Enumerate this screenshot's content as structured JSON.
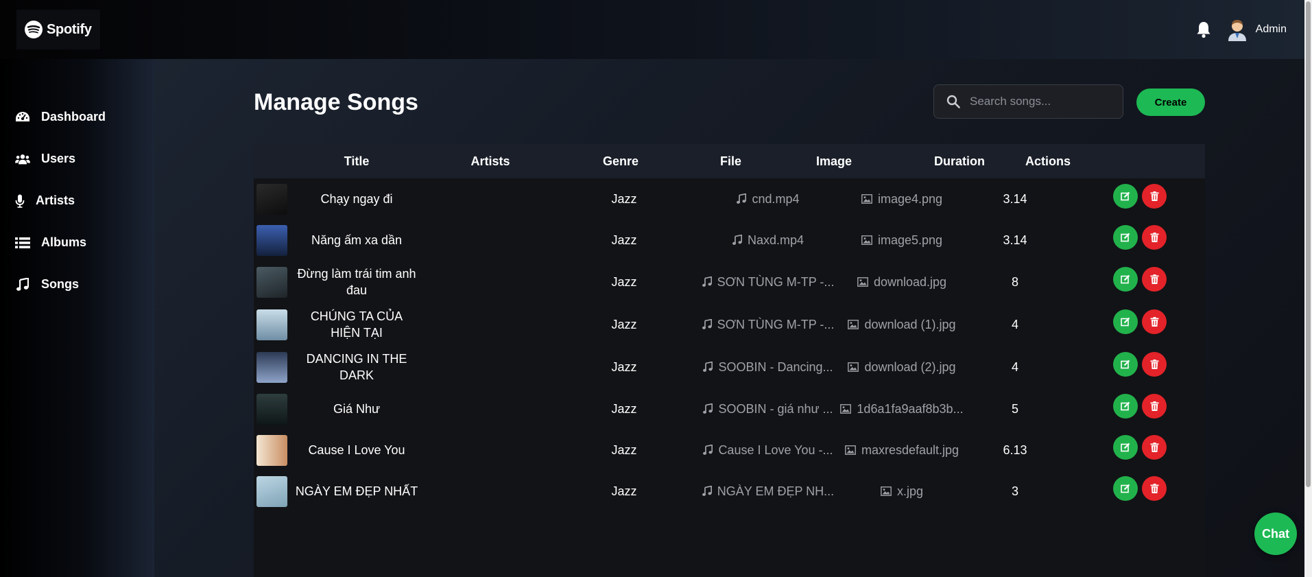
{
  "app": {
    "brand": "Spotify"
  },
  "header": {
    "user_name": "Admin"
  },
  "sidebar": {
    "items": [
      {
        "label": "Dashboard",
        "icon": "dashboard-icon"
      },
      {
        "label": "Users",
        "icon": "users-icon"
      },
      {
        "label": "Artists",
        "icon": "microphone-icon"
      },
      {
        "label": "Albums",
        "icon": "list-icon"
      },
      {
        "label": "Songs",
        "icon": "music-note-icon"
      }
    ]
  },
  "main": {
    "title": "Manage Songs",
    "search_placeholder": "Search songs...",
    "create_label": "Create"
  },
  "table": {
    "columns": [
      "Title",
      "Artists",
      "Genre",
      "File",
      "Image",
      "Duration",
      "Actions"
    ],
    "rows": [
      {
        "title": "Chạy ngay đi",
        "genre": "Jazz",
        "file": "cnd.mp4",
        "image": "image4.png",
        "duration": "3.14"
      },
      {
        "title": "Năng ấm xa dần",
        "genre": "Jazz",
        "file": "Naxd.mp4",
        "image": "image5.png",
        "duration": "3.14"
      },
      {
        "title": "Đừng làm trái tim anh đau",
        "genre": "Jazz",
        "file": "SƠN TÙNG M-TP -...",
        "image": "download.jpg",
        "duration": "8"
      },
      {
        "title": "CHÚNG TA CỦA HIỆN TẠI",
        "genre": "Jazz",
        "file": "SƠN TÙNG M-TP -...",
        "image": "download (1).jpg",
        "duration": "4"
      },
      {
        "title": "DANCING IN THE DARK",
        "genre": "Jazz",
        "file": "SOOBIN - Dancing...",
        "image": "download (2).jpg",
        "duration": "4"
      },
      {
        "title": "Giá Như",
        "genre": "Jazz",
        "file": "SOOBIN - giá như ...",
        "image": "1d6a1fa9aaf8b3b...",
        "duration": "5"
      },
      {
        "title": "Cause I Love You",
        "genre": "Jazz",
        "file": "Cause I Love You -...",
        "image": "maxresdefault.jpg",
        "duration": "6.13"
      },
      {
        "title": "NGÀY EM ĐẸP NHẤT",
        "genre": "Jazz",
        "file": "NGÀY EM ĐẸP NH...",
        "image": "x.jpg",
        "duration": "3"
      }
    ]
  },
  "chat": {
    "label": "Chat"
  },
  "colors": {
    "accent": "#1db954",
    "edit": "#22b24c",
    "delete": "#e32329"
  }
}
